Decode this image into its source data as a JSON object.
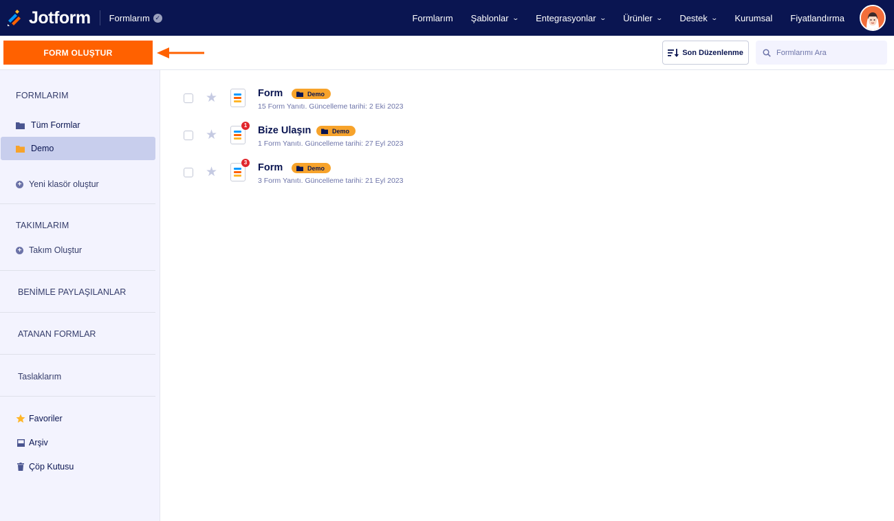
{
  "brand": {
    "name": "Jotform"
  },
  "workspace": {
    "label": "Formlarım"
  },
  "nav": {
    "items": [
      {
        "label": "Formlarım",
        "dropdown": false
      },
      {
        "label": "Şablonlar",
        "dropdown": true
      },
      {
        "label": "Entegrasyonlar",
        "dropdown": true
      },
      {
        "label": "Ürünler",
        "dropdown": true
      },
      {
        "label": "Destek",
        "dropdown": true
      },
      {
        "label": "Kurumsal",
        "dropdown": false
      },
      {
        "label": "Fiyatlandırma",
        "dropdown": false
      }
    ]
  },
  "toolbar": {
    "create_label": "FORM OLUŞTUR",
    "sort_label": "Son Düzenlenme",
    "search_placeholder": "Formlarımı Ara"
  },
  "sidebar": {
    "my_forms_title": "FORMLARIM",
    "all_forms": "Tüm Formlar",
    "demo": "Demo",
    "new_folder": "Yeni klasör oluştur",
    "teams_title": "TAKIMLARIM",
    "create_team": "Takım Oluştur",
    "shared": "BENİMLE PAYLAŞILANLAR",
    "assigned": "ATANAN FORMLAR",
    "drafts": "Taslaklarım",
    "favorites": "Favoriler",
    "archive": "Arşiv",
    "trash": "Çöp Kutusu"
  },
  "forms": [
    {
      "title": "Form",
      "tag": "Demo",
      "meta": "15 Form Yanıtı. Güncelleme tarihi: 2 Eki 2023",
      "new_count": ""
    },
    {
      "title": "Bize Ulaşın",
      "tag": "Demo",
      "meta": "1 Form Yanıtı. Güncelleme tarihi: 27 Eyl 2023",
      "new_count": "1"
    },
    {
      "title": "Form",
      "tag": "Demo",
      "meta": "3 Form Yanıtı. Güncelleme tarihi: 21 Eyl 2023",
      "new_count": "3"
    }
  ],
  "colors": {
    "navbar": "#0a1551",
    "accent": "#ff6100",
    "tag": "#f7a32b",
    "sidebar_bg": "#f3f3fe",
    "active_item": "#c8ceed",
    "badge": "#e1262c"
  }
}
